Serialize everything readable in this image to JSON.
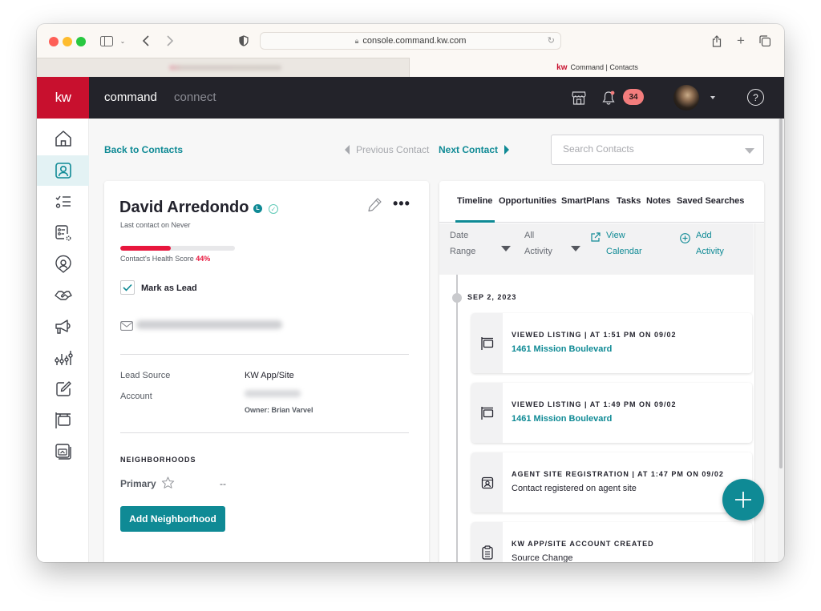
{
  "browser": {
    "url": "console.command.kw.com",
    "active_tab_title": "Command | Contacts",
    "active_tab_logo": "kw"
  },
  "header": {
    "logo": "kw",
    "nav": [
      "command",
      "connect"
    ],
    "notifications_count": "34",
    "help_label": "?"
  },
  "sidebar": {
    "items": [
      {
        "name": "home",
        "icon": "home-icon",
        "active": false
      },
      {
        "name": "contacts",
        "icon": "contact-card-icon",
        "active": true
      },
      {
        "name": "tasks",
        "icon": "checklist-icon",
        "active": false
      },
      {
        "name": "smartplans",
        "icon": "list-settings-icon",
        "active": false
      },
      {
        "name": "referrals",
        "icon": "user-pin-icon",
        "active": false
      },
      {
        "name": "opportunities",
        "icon": "handshake-icon",
        "active": false
      },
      {
        "name": "marketing",
        "icon": "megaphone-icon",
        "active": false
      },
      {
        "name": "reports",
        "icon": "sliders-icon",
        "active": false
      },
      {
        "name": "designs",
        "icon": "edit-icon",
        "active": false
      },
      {
        "name": "listings",
        "icon": "sign-icon",
        "active": false
      },
      {
        "name": "sites",
        "icon": "website-icon",
        "active": false
      }
    ]
  },
  "topnav": {
    "back": "Back to Contacts",
    "previous": "Previous Contact",
    "next": "Next Contact",
    "search_placeholder": "Search Contacts"
  },
  "contact": {
    "name": "David Arredondo",
    "lead_badge": "L",
    "last_contact": "Last contact on Never",
    "health_label": "Contact's Health Score",
    "health_score": "44%",
    "health_fraction": 0.44,
    "mark_as_lead_label": "Mark as Lead",
    "mark_as_lead_checked": true,
    "fields": [
      {
        "label": "Lead Source",
        "value": "KW App/Site"
      },
      {
        "label": "Account",
        "value": ""
      }
    ],
    "owner": "Owner: Brian Varvel",
    "neighborhoods_title": "NEIGHBORHOODS",
    "primary_label": "Primary",
    "primary_value": "--",
    "add_neighborhood": "Add Neighborhood"
  },
  "timeline": {
    "tabs": [
      "Timeline",
      "Opportunities",
      "SmartPlans",
      "Tasks",
      "Notes",
      "Saved Searches"
    ],
    "active_tab": "Timeline",
    "filters": {
      "date_range": [
        "Date",
        "Range"
      ],
      "activity": [
        "All",
        "Activity"
      ],
      "view_calendar": [
        "View",
        "Calendar"
      ],
      "add_activity": [
        "Add",
        "Activity"
      ]
    },
    "date": "SEP 2, 2023",
    "events": [
      {
        "icon": "listing-sign-icon",
        "title": "VIEWED LISTING | AT 1:51 PM ON 09/02",
        "detail": "1461 Mission Boulevard",
        "detail_is_link": true
      },
      {
        "icon": "listing-sign-icon",
        "title": "VIEWED LISTING | AT 1:49 PM ON 09/02",
        "detail": "1461 Mission Boulevard",
        "detail_is_link": true
      },
      {
        "icon": "id-badge-icon",
        "title": "AGENT SITE REGISTRATION | AT 1:47 PM ON 09/02",
        "detail": "Contact registered on agent site",
        "detail_is_link": false
      },
      {
        "icon": "clipboard-icon",
        "title": "KW APP/SITE ACCOUNT CREATED",
        "detail": "Source Change",
        "detail_is_link": false
      }
    ]
  },
  "colors": {
    "brand_red": "#c8102e",
    "teal": "#0f8a95",
    "health_red": "#e8163d",
    "header_bg": "#23232a"
  }
}
